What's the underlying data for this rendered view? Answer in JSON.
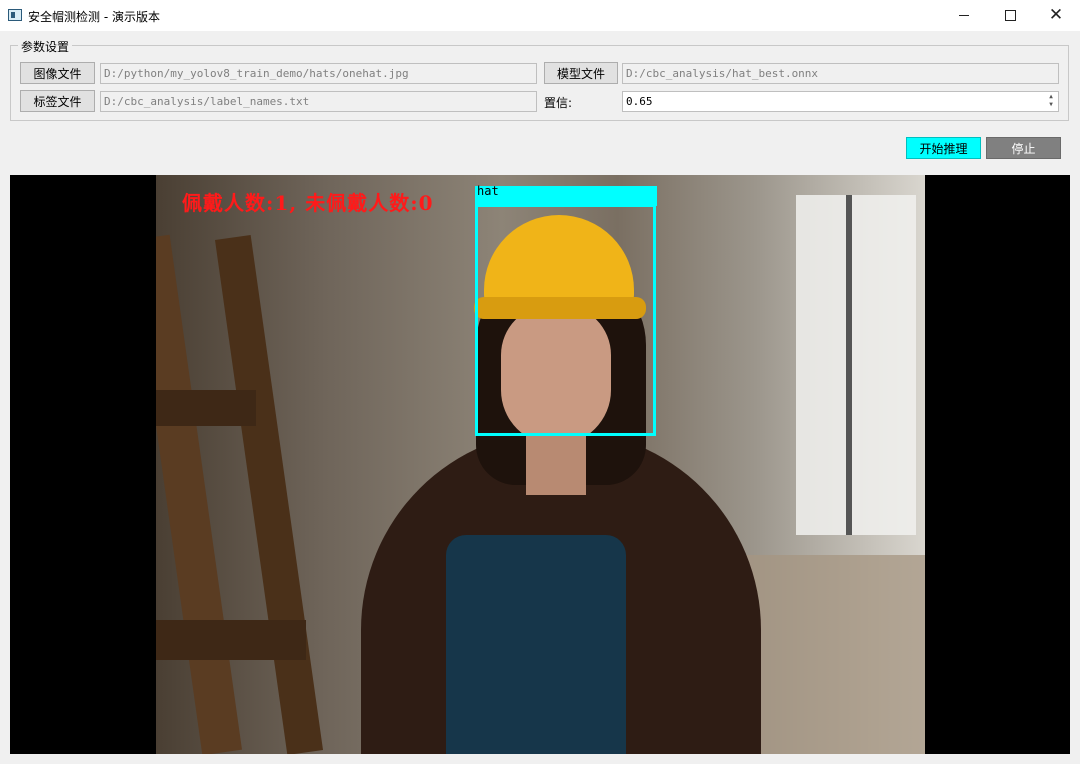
{
  "window": {
    "title": "安全帽测检测 - 演示版本",
    "controls": {
      "minimize": "—",
      "maximize": "☐",
      "close": "✕"
    }
  },
  "params": {
    "group_title": "参数设置",
    "image_file_button": "图像文件",
    "image_path": "D:/python/my_yolov8_train_demo/hats/onehat.jpg",
    "label_file_button": "标签文件",
    "label_path": "D:/cbc_analysis/label_names.txt",
    "model_file_button": "模型文件",
    "model_path": "D:/cbc_analysis/hat_best.onnx",
    "confidence_label": "置信:",
    "confidence_value": "0.65"
  },
  "actions": {
    "start_label": "开始推理",
    "stop_label": "停止",
    "start_color": "#00ffff",
    "stop_color": "#808080"
  },
  "result": {
    "overlay_text": "佩戴人数:1, 未佩戴人数:0",
    "overlay_color": "#ff0000",
    "detections": [
      {
        "label": "hat",
        "color": "#00ffff"
      }
    ]
  },
  "icons": [
    "app-icon",
    "minimize-icon",
    "maximize-icon",
    "close-icon",
    "spin-arrows-icon"
  ]
}
